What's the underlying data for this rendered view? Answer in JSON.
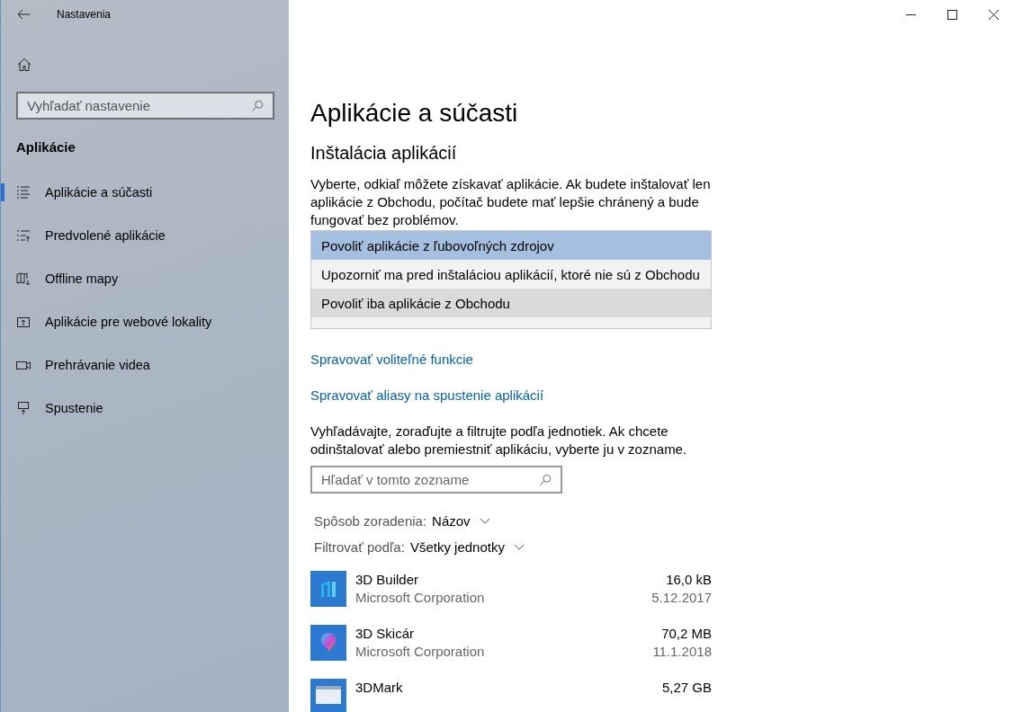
{
  "window": {
    "title": "Nastavenia"
  },
  "sidebar": {
    "search": {
      "placeholder": "Vyhľadať nastavenie"
    },
    "section": "Aplikácie",
    "items": [
      {
        "label": "Aplikácie a súčasti",
        "selected": true
      },
      {
        "label": "Predvolené aplikácie",
        "selected": false
      },
      {
        "label": "Offline mapy",
        "selected": false
      },
      {
        "label": "Aplikácie pre webové lokality",
        "selected": false
      },
      {
        "label": "Prehrávanie videa",
        "selected": false
      },
      {
        "label": "Spustenie",
        "selected": false
      }
    ]
  },
  "content": {
    "title": "Aplikácie a súčasti",
    "section": "Inštalácia aplikácií",
    "description": "Vyberte, odkiaľ môžete získavať aplikácie. Ak budete inštalovať len aplikácie z Obchodu, počítač budete mať lepšie chránený a bude fungovať bez problémov.",
    "dropdown_options": [
      {
        "label": "Povoliť aplikácie z ľubovoľných zdrojov",
        "selected": true,
        "hovered": false
      },
      {
        "label": "Upozorniť ma pred inštaláciou aplikácií, ktoré nie sú z Obchodu",
        "selected": false,
        "hovered": false
      },
      {
        "label": "Povoliť iba aplikácie z Obchodu",
        "selected": false,
        "hovered": true
      }
    ],
    "links": [
      "Spravovať voliteľné funkcie",
      "Spravovať aliasy na spustenie aplikácií"
    ],
    "list_description": "Vyhľadávajte, zoraďujte a filtrujte podľa jednotiek. Ak chcete odinštalovať alebo premiestniť aplikáciu, vyberte ju v zozname.",
    "list_search": {
      "placeholder": "Hľadať v tomto zozname"
    },
    "sort": {
      "label": "Spôsob zoradenia:",
      "value": "Názov"
    },
    "filter": {
      "label": "Filtrovať podľa:",
      "value": "Všetky jednotky"
    },
    "apps": [
      {
        "name": "3D Builder",
        "publisher": "Microsoft Corporation",
        "size": "16,0 kB",
        "date": "5.12.2017"
      },
      {
        "name": "3D Skicár",
        "publisher": "Microsoft Corporation",
        "size": "70,2 MB",
        "date": "11.1.2018"
      },
      {
        "name": "3DMark",
        "size": "5,27 GB"
      }
    ]
  }
}
